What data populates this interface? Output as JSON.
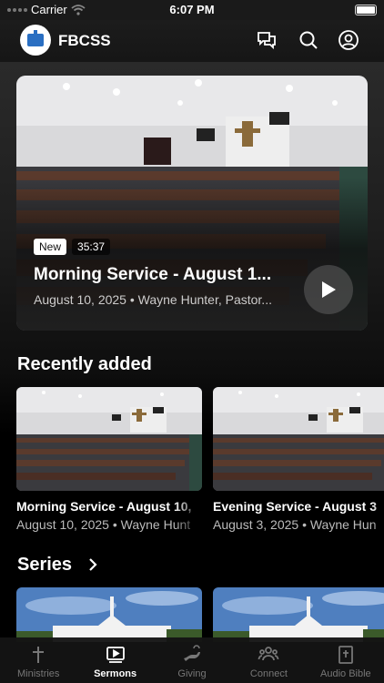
{
  "status_bar": {
    "carrier": "Carrier",
    "time": "6:07 PM"
  },
  "header": {
    "brand": "FBCSS",
    "icons": [
      "chat-bubbles-icon",
      "search-icon",
      "account-icon"
    ]
  },
  "hero": {
    "badge_new": "New",
    "duration": "35:37",
    "title": "Morning Service - August 1...",
    "subtitle": "August 10, 2025 • Wayne Hunter, Pastor...",
    "play_icon": "play-icon"
  },
  "recently_added": {
    "title": "Recently added",
    "items": [
      {
        "title": "Morning Service - August 10,",
        "meta": "August 10, 2025 • Wayne Hunt"
      },
      {
        "title": "Evening Service - August 3",
        "meta": "August 3, 2025 • Wayne Hun"
      }
    ]
  },
  "series": {
    "title": "Series"
  },
  "tabs": [
    {
      "label": "Ministries",
      "icon": "cross-icon",
      "active": false
    },
    {
      "label": "Sermons",
      "icon": "video-library-icon",
      "active": true
    },
    {
      "label": "Giving",
      "icon": "giving-hand-icon",
      "active": false
    },
    {
      "label": "Connect",
      "icon": "group-icon",
      "active": false
    },
    {
      "label": "Audio Bible",
      "icon": "bible-icon",
      "active": false
    }
  ],
  "colors": {
    "background": "#000000",
    "logo_blue": "#2a6fc2",
    "sky": "#4f7fbf"
  }
}
